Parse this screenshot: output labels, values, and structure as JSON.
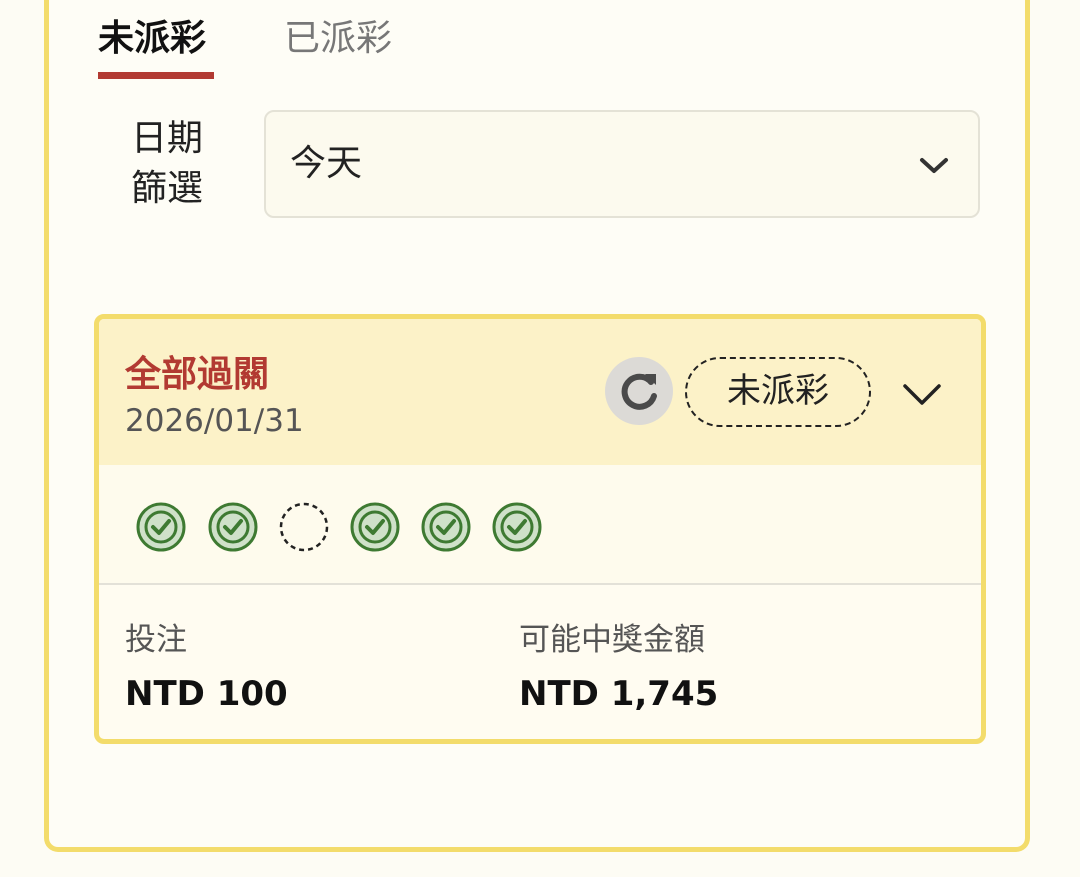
{
  "tabs": [
    {
      "label": "未派彩",
      "active": true
    },
    {
      "label": "已派彩",
      "active": false
    }
  ],
  "filter": {
    "label": "日期篩選",
    "label_line1": "日期",
    "label_line2": "篩選",
    "selected": "今天"
  },
  "bet": {
    "type": "全部過關",
    "date": "2026/01/31",
    "status": "未派彩",
    "legs": [
      "won",
      "won",
      "pending",
      "won",
      "won",
      "won"
    ],
    "stake_label": "投注",
    "stake_value": "NTD 100",
    "payout_label": "可能中獎金額",
    "payout_value": "NTD 1,745"
  },
  "colors": {
    "accent": "#b23a32",
    "border_yellow": "#f3dc6b",
    "won_green": "#3e7a32"
  },
  "icons": {
    "refresh": "refresh-icon",
    "select_chevron": "chevron-down-icon",
    "expand": "chevron-down-icon",
    "leg_won": "check-circle-icon",
    "leg_pending": "dashed-circle-icon"
  }
}
